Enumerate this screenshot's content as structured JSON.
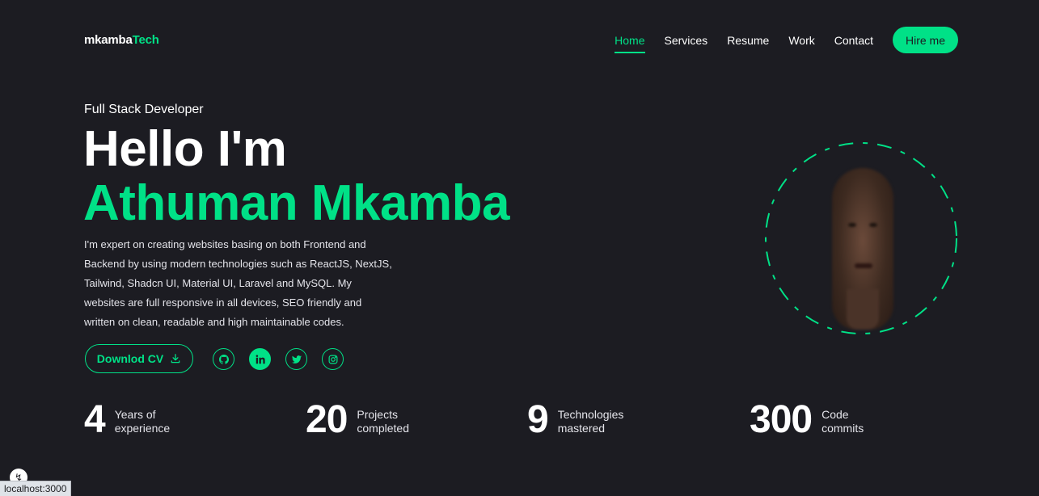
{
  "logo": {
    "main": "mkamba",
    "accent": "Tech"
  },
  "nav": {
    "items": [
      {
        "label": "Home",
        "active": true
      },
      {
        "label": "Services"
      },
      {
        "label": "Resume"
      },
      {
        "label": "Work"
      },
      {
        "label": "Contact"
      }
    ],
    "cta": "Hire me"
  },
  "hero": {
    "role": "Full Stack Developer",
    "greeting": "Hello I'm",
    "name": "Athuman Mkamba",
    "bio": "I'm expert on creating websites basing on both Frontend and Backend by using modern technologies such as ReactJS, NextJS, Tailwind, Shadcn UI, Material UI, Laravel and MySQL. My websites are full responsive in all devices, SEO friendly and written on clean, readable and high maintainable codes.",
    "cv_button": "Downlod CV",
    "socials": [
      "github-icon",
      "linkedin-icon",
      "twitter-icon",
      "instagram-icon"
    ]
  },
  "stats": [
    {
      "value": "4",
      "label_line1": "Years of",
      "label_line2": "experience"
    },
    {
      "value": "20",
      "label_line1": "Projects",
      "label_line2": "completed"
    },
    {
      "value": "9",
      "label_line1": "Technologies",
      "label_line2": "mastered"
    },
    {
      "value": "300",
      "label_line1": "Code",
      "label_line2": "commits"
    }
  ],
  "browser": {
    "status_url": "localhost:3000"
  },
  "colors": {
    "accent": "#00e187",
    "background": "#1c1c22",
    "text": "#ffffff"
  }
}
